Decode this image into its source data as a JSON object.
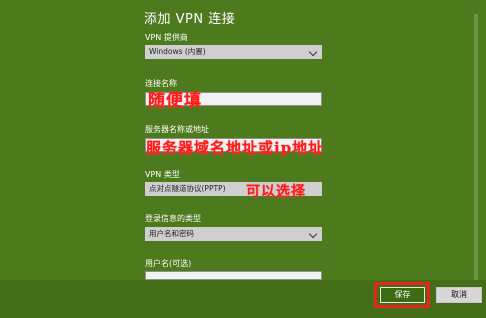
{
  "title": "添加 VPN 连接",
  "fields": {
    "provider": {
      "label": "VPN 提供商",
      "value": "Windows (内置)"
    },
    "connection_name": {
      "label": "连接名称",
      "value": ""
    },
    "server": {
      "label": "服务器名称或地址",
      "value": ""
    },
    "vpn_type": {
      "label": "VPN 类型",
      "value": "点对点隧道协议(PPTP)"
    },
    "signin_type": {
      "label": "登录信息的类型",
      "value": "用户名和密码"
    },
    "username": {
      "label": "用户名(可选)",
      "value": ""
    }
  },
  "annotations": {
    "random": "随便填",
    "server_hint": "服务器域名地址或ip地址",
    "selectable": "可以选择"
  },
  "buttons": {
    "save": "保存",
    "cancel": "取消"
  },
  "colors": {
    "background": "#4d7a1d",
    "annotation": "#ff1a1a",
    "highlight_frame": "#e8241b"
  }
}
